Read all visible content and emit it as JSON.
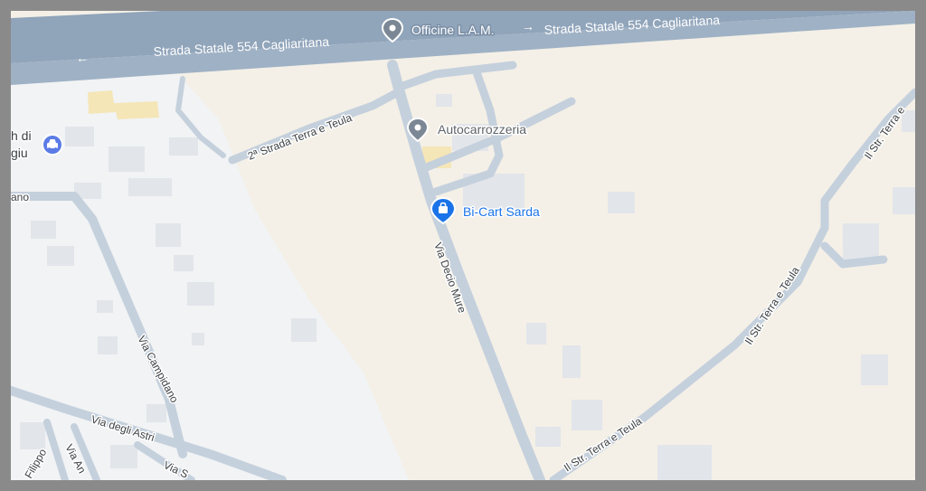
{
  "colors": {
    "land": "#f4f0e7",
    "urban": "#f1f3f4",
    "building": "#e2e5ea",
    "minor_road": "#c5d0dd",
    "highway": "#90a4ba",
    "poi_gray": "#7b8794",
    "poi_blue": "#1a73e8",
    "poi_car": "#5b7ce6"
  },
  "highway": {
    "label_left": "Strada Statale 554 Cagliaritana",
    "label_right": "Strada Statale 554 Cagliaritana"
  },
  "streets": {
    "strada_terra_teula_2": "2ª Strada Terra e Teula",
    "via_decio_mure": "Via Decio Mure",
    "via_campidano": "Via Campidano",
    "via_degli_astri": "Via degli Astri",
    "il_str_terra_teula_top": "Il Str. Terra e",
    "il_str_terra_teula_mid": "Il Str. Terra e Teula",
    "il_str_terra_teula_bottom": "Il Str. Terra e Teula",
    "via_filippo": "Filippo",
    "via_an": "Via An",
    "via_s": "Via S",
    "ano_fragment": "ano",
    "left_poi_line1": "h di",
    "left_poi_line2": "giu"
  },
  "pois": [
    {
      "name": "Officine L.A.M.",
      "icon": "map-pin-icon",
      "color": "#7b8794"
    },
    {
      "name": "Autocarrozzeria",
      "icon": "map-pin-icon",
      "color": "#7b8794"
    },
    {
      "name": "Bi-Cart Sarda",
      "icon": "shopping-bag-icon",
      "color": "#1a73e8"
    },
    {
      "name": "",
      "icon": "car-icon",
      "color": "#5b7ce6"
    }
  ]
}
